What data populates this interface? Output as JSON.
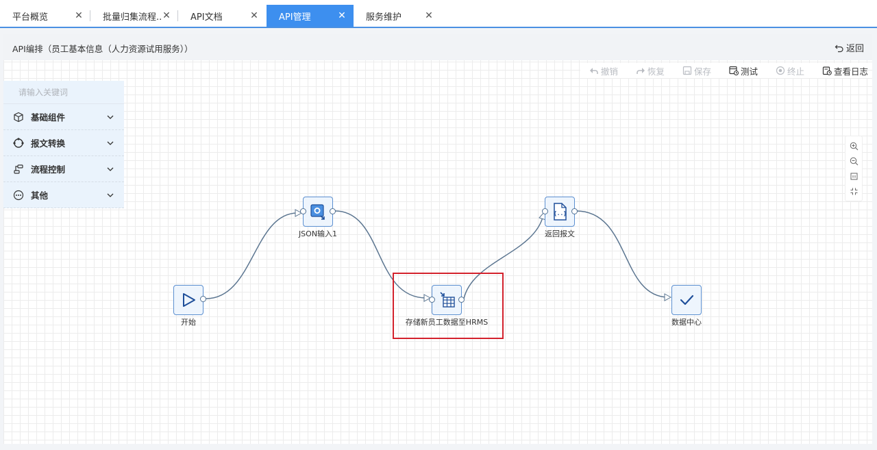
{
  "tabs": [
    {
      "label": "平台概览",
      "active": false
    },
    {
      "label": "批量归集流程...",
      "active": false
    },
    {
      "label": "API文档",
      "active": false
    },
    {
      "label": "API管理",
      "active": true
    },
    {
      "label": "服务维护",
      "active": false
    }
  ],
  "header": {
    "title": "API编排（员工基本信息（人力资源试用服务））",
    "back_label": "返回"
  },
  "toolbar": {
    "undo": "撤销",
    "redo": "恢复",
    "save": "保存",
    "test": "测试",
    "stop": "终止",
    "log": "查看日志"
  },
  "sidebar": {
    "search_placeholder": "请输入关键词",
    "groups": [
      {
        "label": "基础组件",
        "icon": "cube-icon"
      },
      {
        "label": "报文转换",
        "icon": "convert-icon"
      },
      {
        "label": "流程控制",
        "icon": "flow-control-icon"
      },
      {
        "label": "其他",
        "icon": "more-icon"
      }
    ]
  },
  "zoom_controls": [
    "zoom-in-icon",
    "zoom-out-icon",
    "fit-icon",
    "fullscreen-icon"
  ],
  "flow": {
    "nodes": [
      {
        "id": "start",
        "label": "开始",
        "icon": "play-icon"
      },
      {
        "id": "json",
        "label": "JSON输入1",
        "icon": "json-input-icon"
      },
      {
        "id": "store",
        "label": "存储新员工数据至HRMS",
        "icon": "table-store-icon"
      },
      {
        "id": "ret",
        "label": "返回报文",
        "icon": "json-file-icon"
      },
      {
        "id": "center",
        "label": "数据中心",
        "icon": "check-icon"
      }
    ],
    "edges": [
      [
        "start",
        "json"
      ],
      [
        "json",
        "store"
      ],
      [
        "store",
        "ret"
      ],
      [
        "ret",
        "center"
      ]
    ],
    "highlighted_node": "store"
  },
  "colors": {
    "accent": "#3d8fef",
    "highlight": "#d3212c",
    "node_border": "#5b8fd0"
  }
}
